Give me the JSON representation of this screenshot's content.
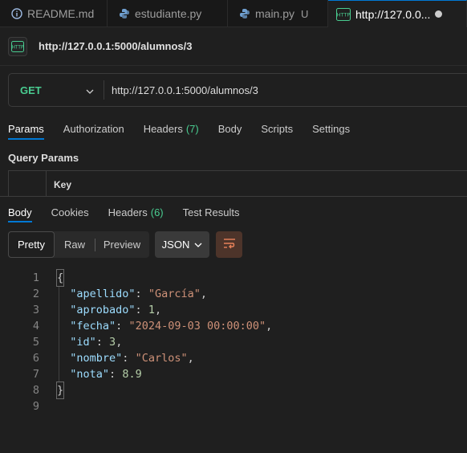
{
  "tabs": [
    {
      "label": "README.md",
      "icon": "info-icon"
    },
    {
      "label": "estudiante.py",
      "icon": "python-icon"
    },
    {
      "label": "main.py",
      "icon": "python-icon",
      "status": "U"
    },
    {
      "label": "http://127.0.0...",
      "icon": "http-icon",
      "active": true
    }
  ],
  "request": {
    "title_url": "http://127.0.0.1:5000/alumnos/3",
    "method": "GET",
    "url": "http://127.0.0.1:5000/alumnos/3"
  },
  "request_tabs": {
    "params": "Params",
    "authorization": "Authorization",
    "headers": "Headers",
    "headers_count": "(7)",
    "body": "Body",
    "scripts": "Scripts",
    "settings": "Settings"
  },
  "query_params": {
    "label": "Query Params",
    "key_header": "Key"
  },
  "response_tabs": {
    "body": "Body",
    "cookies": "Cookies",
    "headers": "Headers",
    "headers_count": "(6)",
    "test_results": "Test Results"
  },
  "response_toolbar": {
    "pretty": "Pretty",
    "raw": "Raw",
    "preview": "Preview",
    "format": "JSON"
  },
  "response_body": {
    "line_numbers": [
      "1",
      "2",
      "3",
      "4",
      "5",
      "6",
      "7",
      "8",
      "9"
    ],
    "open_brace": "{",
    "close_brace": "}",
    "fields": [
      {
        "key": "\"apellido\"",
        "value": "\"García\"",
        "type": "string"
      },
      {
        "key": "\"aprobado\"",
        "value": "1",
        "type": "number"
      },
      {
        "key": "\"fecha\"",
        "value": "\"2024-09-03 00:00:00\"",
        "type": "string"
      },
      {
        "key": "\"id\"",
        "value": "3",
        "type": "number"
      },
      {
        "key": "\"nombre\"",
        "value": "\"Carlos\"",
        "type": "string"
      },
      {
        "key": "\"nota\"",
        "value": "8.9",
        "type": "number"
      }
    ]
  },
  "colors": {
    "method_get": "#49cc90",
    "active_tab_underline": "#0078d4",
    "json_key": "#9cdcfe",
    "json_string": "#ce9178",
    "json_number": "#b5cea8"
  }
}
